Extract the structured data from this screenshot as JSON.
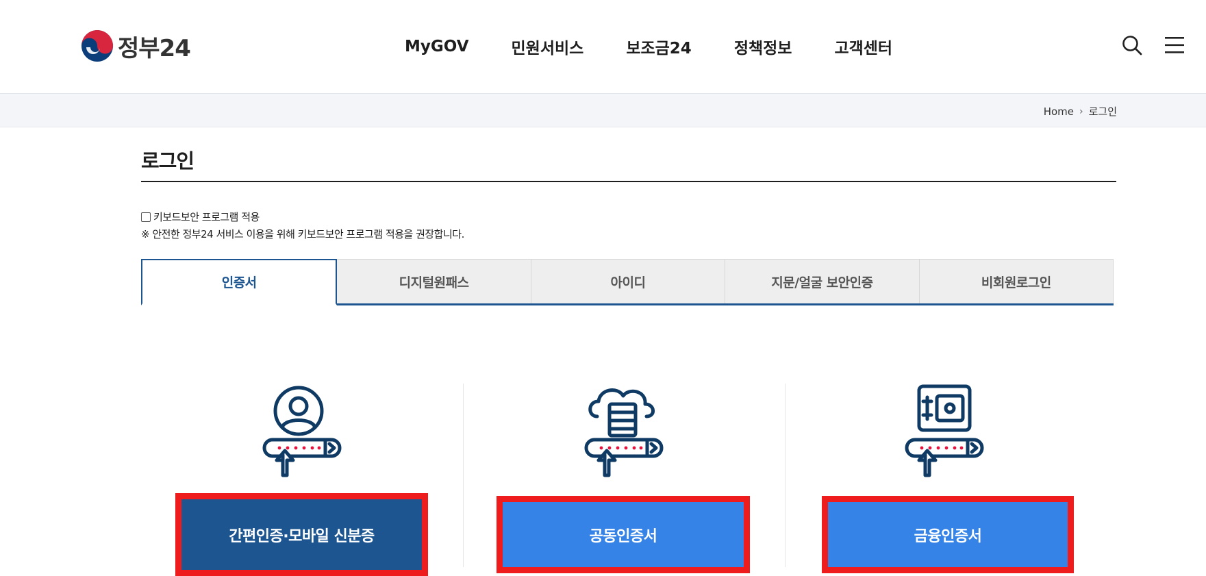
{
  "header": {
    "logo_text": "정부24",
    "nav": [
      "MyGOV",
      "민원서비스",
      "보조금24",
      "정책정보",
      "고객센터"
    ],
    "search_icon": "search-icon",
    "menu_icon": "hamburger-menu-icon"
  },
  "breadcrumb": {
    "home": "Home",
    "current": "로그인"
  },
  "page": {
    "title": "로그인",
    "keyboard_security_label": "키보드보안 프로그램 적용",
    "keyboard_security_checked": false,
    "keyboard_security_note": "※ 안전한 정부24 서비스 이용을 위해 키보드보안 프로그램 적용을 권장합니다."
  },
  "tabs": [
    {
      "label": "인증서",
      "active": true
    },
    {
      "label": "디지털원패스",
      "active": false
    },
    {
      "label": "아이디",
      "active": false
    },
    {
      "label": "지문/얼굴 보안인증",
      "active": false
    },
    {
      "label": "비회원로그인",
      "active": false
    }
  ],
  "cards": [
    {
      "icon": "user-password-icon",
      "button_label": "간편인증·모바일 신분증"
    },
    {
      "icon": "cloud-server-password-icon",
      "button_label": "공동인증서"
    },
    {
      "icon": "safe-password-icon",
      "button_label": "금융인증서"
    }
  ],
  "colors": {
    "primary": "#1d5591",
    "button_light": "#3583e6",
    "highlight_frame": "#ee1c1c",
    "icon_stroke": "#0f3a63",
    "dot_red": "#e5123d"
  }
}
